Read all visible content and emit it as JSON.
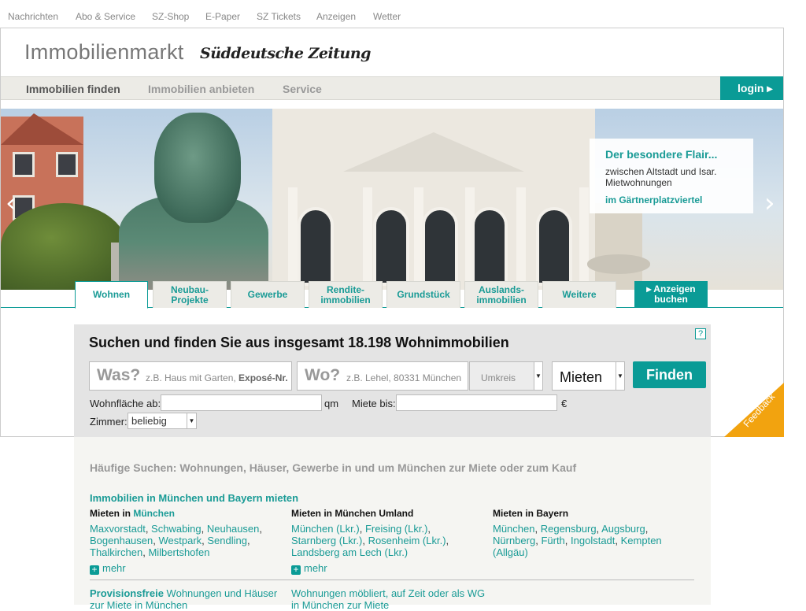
{
  "topnav": [
    "Nachrichten",
    "Abo & Service",
    "SZ-Shop",
    "E-Paper",
    "SZ Tickets",
    "Anzeigen",
    "Wetter"
  ],
  "brand": {
    "title": "Immobilienmarkt",
    "logo_text": "Süddeutsche Zeitung"
  },
  "mainnav": {
    "items": [
      "Immobilien finden",
      "Immobilien anbieten",
      "Service"
    ],
    "login": "login ▸"
  },
  "hero": {
    "flair_title": "Der besondere Flair...",
    "flair_desc": "zwischen Altstadt und Isar. Mietwohnungen",
    "flair_link": "im Gärtnerplatzviertel",
    "prev": "‹",
    "next": "›"
  },
  "tabs": [
    "Wohnen",
    "Neubau-\nProjekte",
    "Gewerbe",
    "Rendite-\nimmobilien",
    "Grundstück",
    "Auslands-\nimmobilien",
    "Weitere",
    "▸ Anzeigen\nbuchen"
  ],
  "search": {
    "heading": "Suchen und finden Sie aus insgesamt 18.198 Wohnimmobilien",
    "help": "?",
    "was_label": "Was?",
    "was_placeholder": "z.B. Haus mit Garten, ",
    "was_placeholder_bold": "Exposé-Nr.",
    "wo_label": "Wo?",
    "wo_placeholder": "z.B. Lehel, 80331 München",
    "umkreis": "Umkreis",
    "mode": "Mieten",
    "submit": "Finden",
    "wohnflaeche_label": "Wohnfläche ab:",
    "qm": "qm",
    "miete_label": "Miete bis:",
    "euro": "€",
    "zimmer_label": "Zimmer:",
    "zimmer_value": "beliebig"
  },
  "feedback": "Feedback",
  "lower": {
    "heading": "Häufige Suchen: Wohnungen, Häuser, Gewerbe in und um München zur Miete oder zum Kauf",
    "section_title": "Immobilien in München und Bayern mieten",
    "columns": [
      {
        "head": "Mieten in ",
        "head_link": "München",
        "links": [
          "Maxvorstadt",
          "Schwabing",
          "Neuhausen",
          "Bogenhausen",
          "Westpark",
          "Sendling",
          "Thalkirchen",
          "Milbertshofen"
        ]
      },
      {
        "head": "Mieten in München Umland",
        "head_link": "",
        "links": [
          "München (Lkr.)",
          "Freising (Lkr.)",
          "Starnberg (Lkr.)",
          "Rosenheim (Lkr.)",
          "Landsberg am Lech (Lkr.)"
        ]
      },
      {
        "head": "Mieten in Bayern",
        "head_link": "",
        "links": [
          "München",
          "Regensburg",
          "Augsburg",
          "Nürnberg",
          "Fürth",
          "Ingolstadt",
          "Kempten (Allgäu)"
        ]
      }
    ],
    "mehr": "mehr",
    "bottom_left_bold": "Provisionsfreie",
    "bottom_left": " Wohnungen und Häuser zur Miete in München",
    "bottom_mid": "Wohnungen möbliert, auf Zeit oder als WG in München zur Miete"
  },
  "colors": {
    "accent": "#0a9b96",
    "feedback": "#f2a30f",
    "panel": "#e4e4e4"
  }
}
